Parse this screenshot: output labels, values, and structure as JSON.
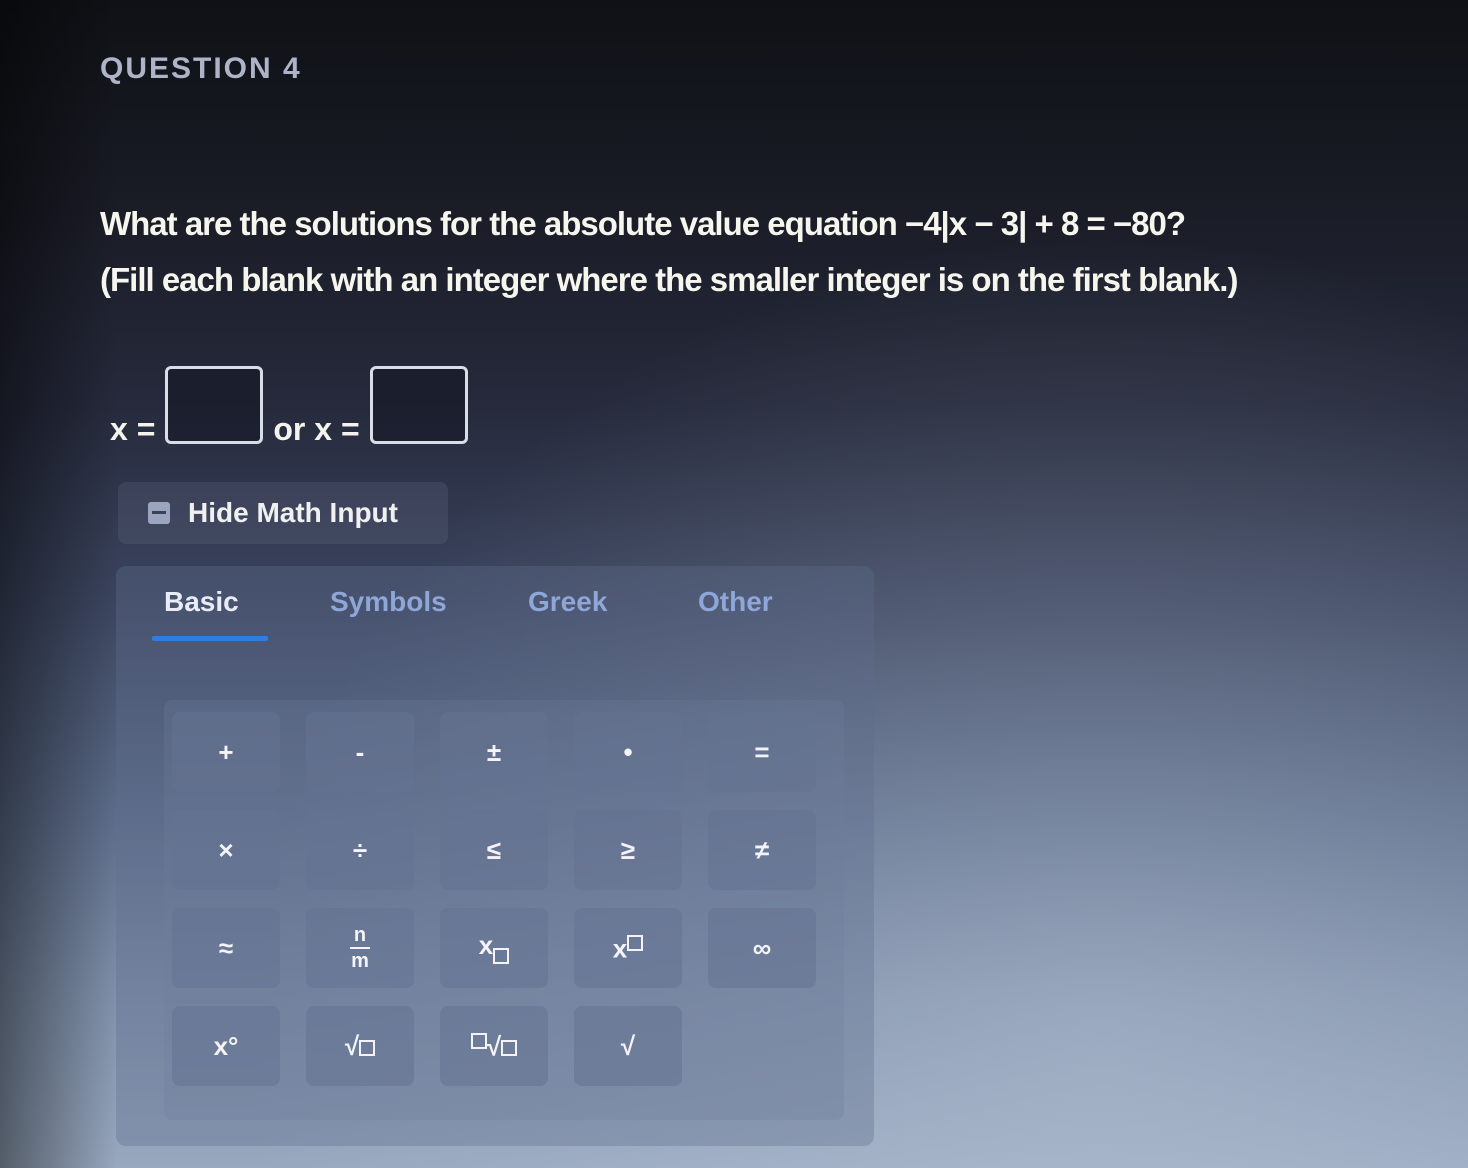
{
  "question": {
    "label": "QUESTION 4",
    "line1": "What are the solutions for the absolute value equation −4|x − 3| + 8 = −80?",
    "line2": "(Fill each blank with an integer where the smaller integer is on the first blank.)"
  },
  "answer": {
    "prefix": "x =",
    "connector": "or x ="
  },
  "math_input": {
    "hide_label": "Hide Math Input",
    "tabs": [
      "Basic",
      "Symbols",
      "Greek",
      "Other"
    ],
    "active_tab": "Basic"
  },
  "keys": {
    "plus": "+",
    "minus": "-",
    "plus_minus": "±",
    "dot": "•",
    "equals": "=",
    "times": "×",
    "divide": "÷",
    "le": "≤",
    "ge": "≥",
    "ne": "≠",
    "approx": "≈",
    "frac_num": "n",
    "frac_den": "m",
    "sub_base": "x",
    "sup_base": "x",
    "infinity": "∞",
    "degree": "x°",
    "sqrt": "√",
    "nthroot": "√",
    "check": "√"
  }
}
